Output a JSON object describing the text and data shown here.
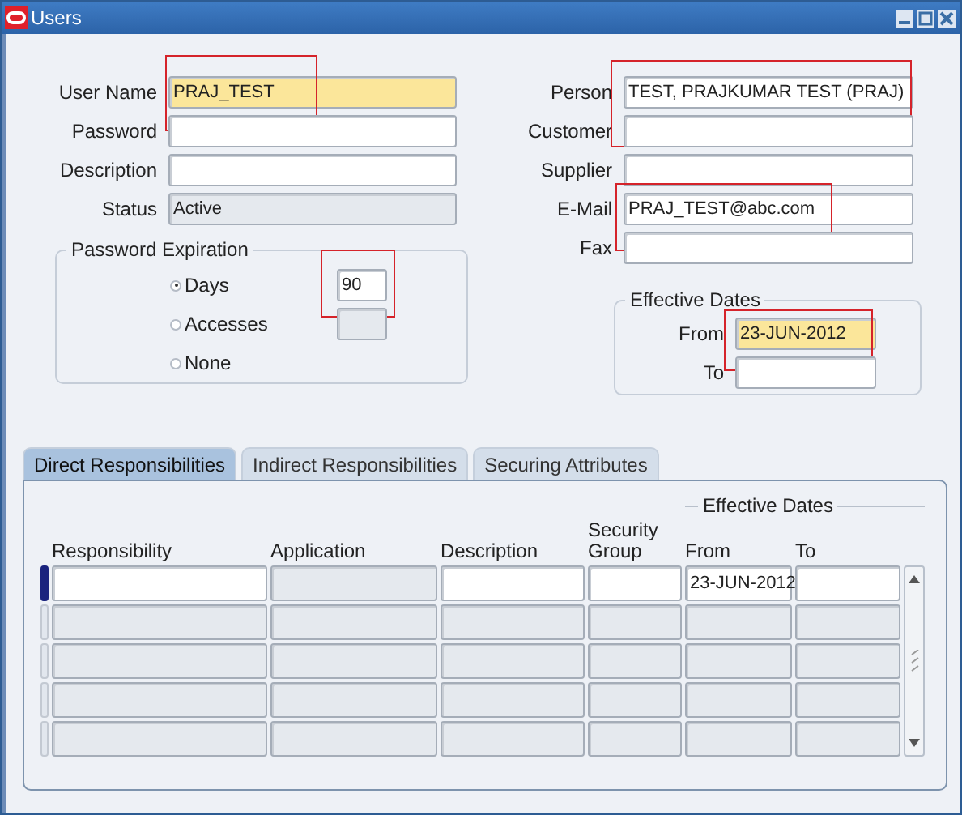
{
  "window": {
    "title": "Users"
  },
  "user_fields": [
    {
      "label": "User Name",
      "value": "PRAJ_TEST",
      "kind": "required",
      "highlighted": true
    },
    {
      "label": "Password",
      "kind": "editable",
      "highlighted": false
    },
    {
      "label": "Description",
      "kind": "editable",
      "highlighted": false
    },
    {
      "label": "Status",
      "value": "Active",
      "kind": "readonly",
      "highlighted": false
    }
  ],
  "link_fields": [
    {
      "label": "Person",
      "value": "TEST, PRAJKUMAR TEST (PRAJ)",
      "kind": "editable",
      "highlighted": true
    },
    {
      "label": "Customer",
      "kind": "editable",
      "highlighted": false
    },
    {
      "label": "Supplier",
      "kind": "editable",
      "highlighted": false
    },
    {
      "label": "E-Mail",
      "value": "PRAJ_TEST@abc.com",
      "kind": "editable",
      "highlighted": true
    },
    {
      "label": "Fax",
      "kind": "editable",
      "highlighted": false
    }
  ],
  "password_expiration": {
    "title": "Password Expiration",
    "options": [
      {
        "label": "Days",
        "selected": true,
        "field": {
          "value": "90",
          "kind": "editable",
          "highlighted": true
        }
      },
      {
        "label": "Accesses",
        "selected": false,
        "field": {
          "kind": "readonly",
          "highlighted": false
        }
      },
      {
        "label": "None",
        "selected": false
      }
    ]
  },
  "effective_dates": {
    "title": "Effective Dates",
    "fields": [
      {
        "label": "From",
        "value": "23-JUN-2012",
        "kind": "required",
        "highlighted": true
      },
      {
        "label": "To",
        "kind": "editable",
        "highlighted": false
      }
    ]
  },
  "tabs": [
    {
      "label": "Direct Responsibilities",
      "selected": true
    },
    {
      "label": "Indirect Responsibilities",
      "selected": false
    },
    {
      "label": "Securing Attributes",
      "selected": false
    }
  ],
  "table": {
    "group_header": "Effective Dates",
    "columns": [
      "Responsibility",
      "Application",
      "Description",
      "Security Group",
      "From",
      "To"
    ],
    "rows": [
      {
        "current": true,
        "cells": [
          {
            "kind": "editable"
          },
          {
            "kind": "readonly"
          },
          {
            "kind": "editable"
          },
          {
            "kind": "editable"
          },
          {
            "kind": "editable",
            "value": "23-JUN-2012"
          },
          {
            "kind": "editable"
          }
        ]
      },
      {
        "current": false,
        "cells": [
          {
            "kind": "readonly"
          },
          {
            "kind": "readonly"
          },
          {
            "kind": "readonly"
          },
          {
            "kind": "readonly"
          },
          {
            "kind": "readonly"
          },
          {
            "kind": "readonly"
          }
        ]
      },
      {
        "current": false,
        "cells": [
          {
            "kind": "readonly"
          },
          {
            "kind": "readonly"
          },
          {
            "kind": "readonly"
          },
          {
            "kind": "readonly"
          },
          {
            "kind": "readonly"
          },
          {
            "kind": "readonly"
          }
        ]
      },
      {
        "current": false,
        "cells": [
          {
            "kind": "readonly"
          },
          {
            "kind": "readonly"
          },
          {
            "kind": "readonly"
          },
          {
            "kind": "readonly"
          },
          {
            "kind": "readonly"
          },
          {
            "kind": "readonly"
          }
        ]
      },
      {
        "current": false,
        "cells": [
          {
            "kind": "readonly"
          },
          {
            "kind": "readonly"
          },
          {
            "kind": "readonly"
          },
          {
            "kind": "readonly"
          },
          {
            "kind": "readonly"
          },
          {
            "kind": "readonly"
          }
        ]
      }
    ]
  }
}
